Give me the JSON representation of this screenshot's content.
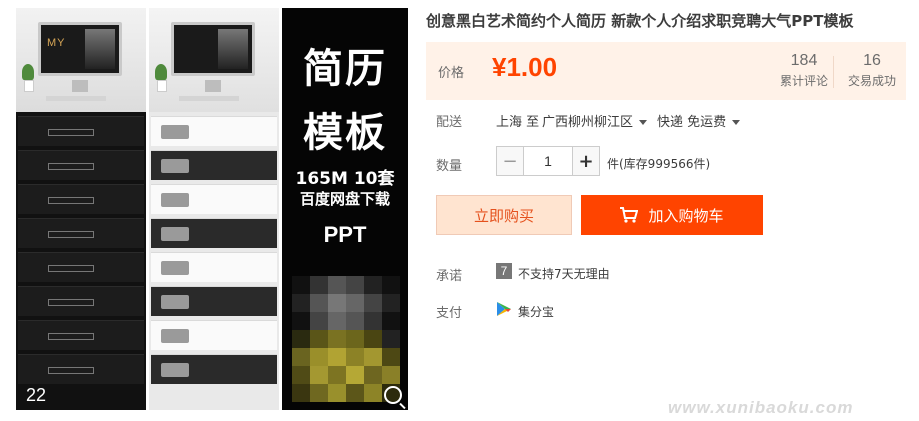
{
  "product": {
    "title": "创意黑白艺术简约个人简历 新款个人介绍求职竞聘大气PPT模板"
  },
  "gallery": {
    "monitor_text": "MY",
    "corner_number": "22",
    "promo_line1": "简历",
    "promo_line2": "模板",
    "promo_line3": "165M 10套",
    "promo_line4": "百度网盘下载",
    "promo_line5": "PPT"
  },
  "price": {
    "label": "价格",
    "value": "¥1.00",
    "reviews_count": "184",
    "reviews_label": "累计评论",
    "sales_count": "16",
    "sales_label": "交易成功"
  },
  "shipping": {
    "label": "配送",
    "from": "上海 至",
    "to": "广西柳州柳江区",
    "method": "快递 免运费"
  },
  "quantity": {
    "label": "数量",
    "minus": "−",
    "value": "1",
    "plus": "+",
    "stock": "件(库存999566件)"
  },
  "actions": {
    "buy_now": "立即购买",
    "add_to_cart": "加入购物车"
  },
  "promise": {
    "label": "承诺",
    "icon_text": "7",
    "text": "不支持7天无理由"
  },
  "payment": {
    "label": "支付",
    "text": "集分宝"
  },
  "watermark": "www.xunibaoku.com",
  "colors": {
    "accent": "#ff4400",
    "price_bg": "#fff2e8",
    "buy_now_bg": "#ffe4d0"
  }
}
